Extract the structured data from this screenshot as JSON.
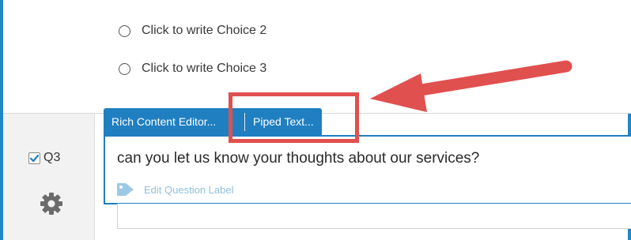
{
  "choices": [
    {
      "label": "Click to write Choice 2"
    },
    {
      "label": "Click to write Choice 3"
    }
  ],
  "question": {
    "id_label": "Q3",
    "checked": true,
    "text": "can you let us know your thoughts about our services?",
    "edit_label_link": "Edit Question Label"
  },
  "toolbar": {
    "rich_content": "Rich Content Editor...",
    "piped_text": "Piped Text..."
  },
  "colors": {
    "accent": "#1f7fc1",
    "annotation": "#e0504f"
  }
}
